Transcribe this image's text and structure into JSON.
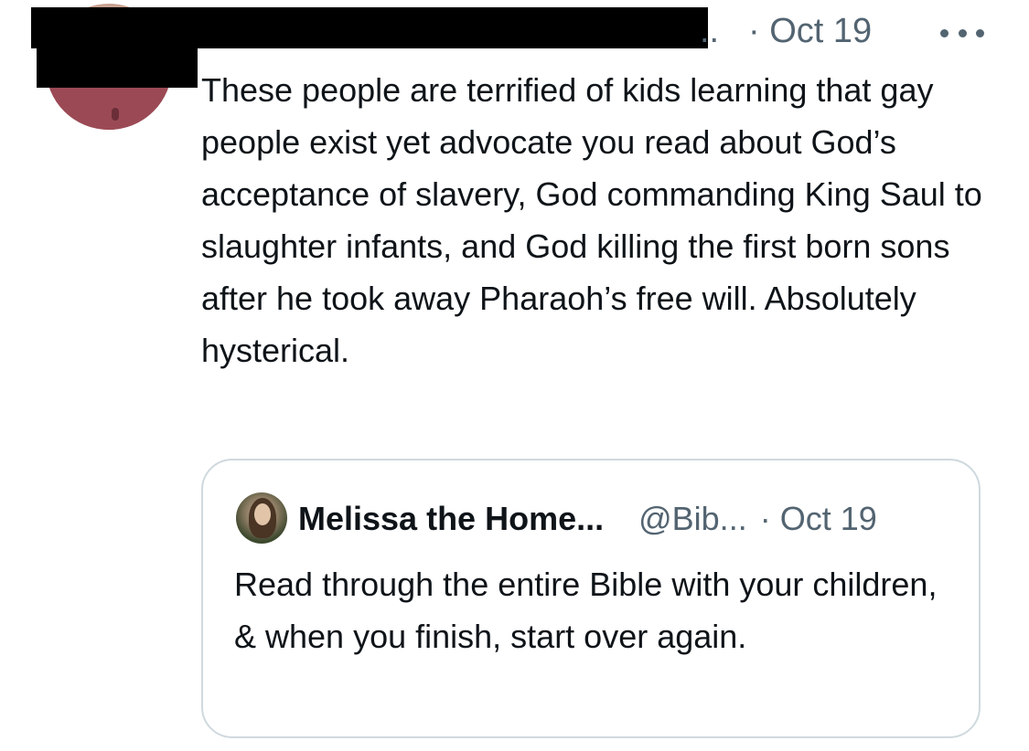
{
  "tweet": {
    "name_truncation": "..",
    "date": "· Oct 19",
    "text": "These people are terrified of kids learning that gay people exist yet advocate you read about God’s acceptance of slavery, God commanding King Saul to slaughter infants, and God killing the first born sons after he took away Pharaoh’s free will. Absolutely hysterical.",
    "more_icon": "more-horizontal-icon"
  },
  "quoted_tweet": {
    "name": "Melissa the Home...",
    "handle": "@Bib...",
    "date": "· Oct 19",
    "text": "Read through the entire Bible with your children, & when you finish, start over again."
  },
  "colors": {
    "text_primary": "#0f1419",
    "text_secondary": "#536471",
    "border": "#cfd9de",
    "redaction": "#000000"
  }
}
